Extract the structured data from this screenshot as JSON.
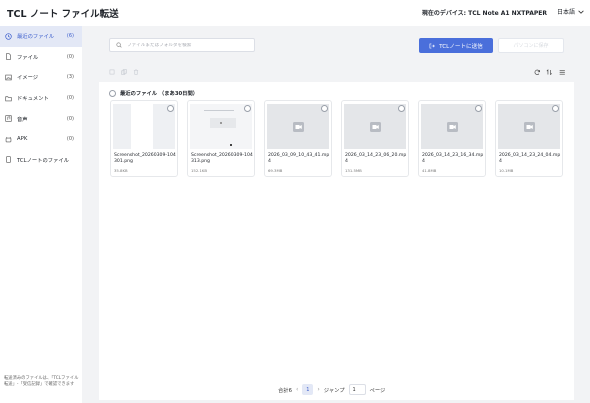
{
  "header": {
    "app_title": "TCL ノート ファイル転送",
    "device_label": "現在のデバイス: TCL Note A1 NXTPAPER",
    "language": "日本語"
  },
  "sidebar": {
    "items": [
      {
        "label": "最近のファイル",
        "count": "(6)",
        "icon": "clock-icon"
      },
      {
        "label": "ファイル",
        "count": "(0)",
        "icon": "file-icon"
      },
      {
        "label": "イメージ",
        "count": "(3)",
        "icon": "image-icon"
      },
      {
        "label": "ドキュメント",
        "count": "(0)",
        "icon": "document-icon"
      },
      {
        "label": "音声",
        "count": "(0)",
        "icon": "audio-icon"
      },
      {
        "label": "APK",
        "count": "(0)",
        "icon": "apk-icon"
      },
      {
        "label": "TCLノートのファイル",
        "count": "",
        "icon": "tablet-icon"
      }
    ],
    "note": "転送済みのファイルは、「TCLファイル転送」-「受信記録」で確認できます"
  },
  "toolbar": {
    "search_placeholder": "ファイルまたはフォルダを検索",
    "send_label": "TCLノートに送信",
    "disabled_label": "パソコンに保存"
  },
  "group": {
    "title": "最近のファイル （まあ30日間）"
  },
  "files": [
    {
      "name": "Screenshot_20260309-104301.png",
      "size": "35.8KB",
      "kind": "image"
    },
    {
      "name": "Screenshot_20260309-104313.png",
      "size": "152.1KB",
      "kind": "image"
    },
    {
      "name": "2026_03_09_10_43_41.mp4",
      "size": "69.3MB",
      "kind": "video"
    },
    {
      "name": "2026_03_14_23_06_20.mp4",
      "size": "131.5MB",
      "kind": "video"
    },
    {
      "name": "2026_03_14_23_16_34.mp4",
      "size": "41.8MB",
      "kind": "video"
    },
    {
      "name": "2026_03_14_23_24_04.mp4",
      "size": "10.1MB",
      "kind": "video"
    }
  ],
  "pagination": {
    "total": "合計6",
    "current_page": "1",
    "jump_label": "ジャンプ",
    "jump_value": "1",
    "page_suffix": "ページ"
  },
  "colors": {
    "accent": "#4a6fdb",
    "active_bg": "#e3e8f6",
    "page_bg": "#f2f3f5"
  }
}
